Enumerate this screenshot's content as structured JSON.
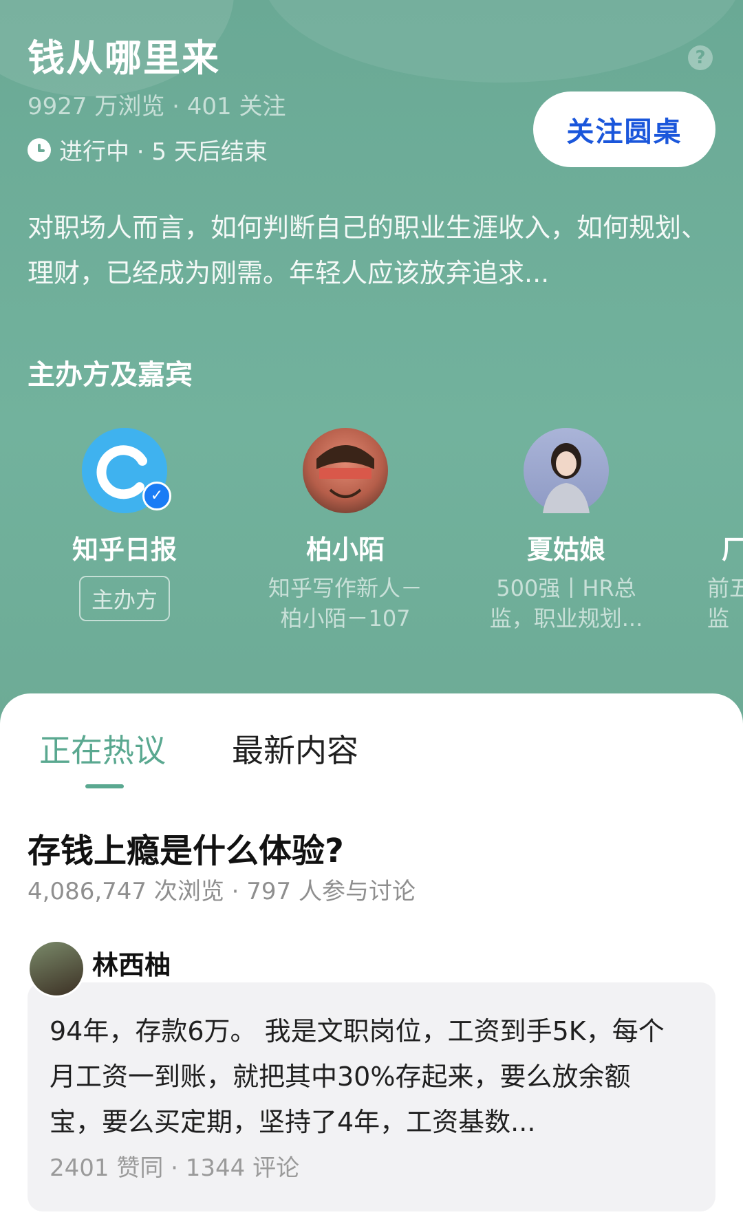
{
  "header": {
    "title": "钱从哪里来",
    "meta": "9927 万浏览 · 401 关注",
    "status": "进行中 · 5 天后结束",
    "follow_label": "关注圆桌",
    "description": "对职场人而言，如何判断自己的职业生涯收入，如何规划、理财，已经成为刚需。年轻人应该放弃追求..."
  },
  "guests": {
    "section_title": "主办方及嘉宾",
    "items": [
      {
        "name": "知乎日报",
        "badge": "主办方"
      },
      {
        "name": "柏小陌",
        "subtitle_l1": "知乎写作新人－",
        "subtitle_l2": "柏小陌－107"
      },
      {
        "name": "夏姑娘",
        "subtitle_l1": "500强丨HR总",
        "subtitle_l2": "监，职业规划..."
      },
      {
        "name": "厂",
        "subtitle_l1": "前五",
        "subtitle_l2": "监"
      }
    ]
  },
  "tabs": [
    "正在热议",
    "最新内容"
  ],
  "question": {
    "title": "存钱上瘾是什么体验?",
    "meta": "4,086,747 次浏览 · 797 人参与讨论"
  },
  "answer": {
    "author": "林西柚",
    "text": "94年，存款6万。 我是文职岗位，工资到手5K，每个月工资一到账，就把其中30%存起来，要么放余额宝，要么买定期，坚持了4年，工资基数...",
    "meta": "2401 赞同 · 1344 评论"
  },
  "colors": {
    "accent": "#5aa890",
    "brand_blue": "#1a56db",
    "hero_bg": "#6fae98"
  },
  "icons": [
    "clock-icon",
    "help-icon",
    "verified-icon"
  ]
}
